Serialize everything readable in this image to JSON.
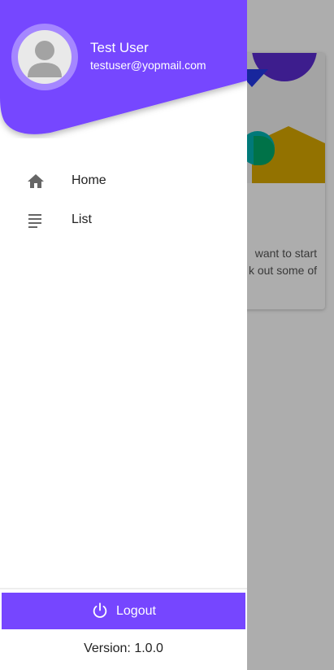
{
  "colors": {
    "accent": "#7646ff",
    "scrim": "rgba(0,0,0,0.32)"
  },
  "background_card": {
    "text_line_1": "want to start",
    "text_line_2": "k out some of"
  },
  "drawer": {
    "user": {
      "name": "Test User",
      "email": "testuser@yopmail.com",
      "avatar_icon": "person-icon"
    },
    "nav_items": [
      {
        "label": "Home",
        "icon": "home-icon"
      },
      {
        "label": "List",
        "icon": "list-icon"
      }
    ],
    "logout": {
      "label": "Logout",
      "icon": "power-icon"
    },
    "version": {
      "label": "Version:",
      "value": "1.0.0"
    }
  }
}
